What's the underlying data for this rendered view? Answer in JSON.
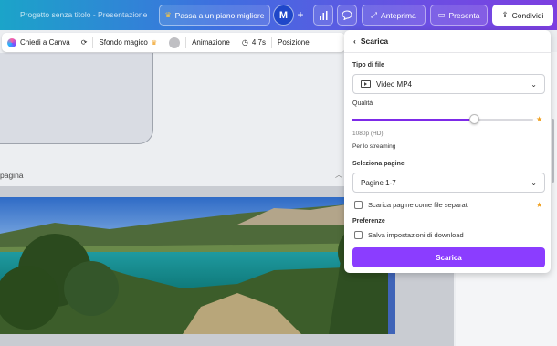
{
  "topbar": {
    "doc_title": "Progetto senza titolo - Presentazione",
    "upgrade_label": "Passa a un piano migliore",
    "avatar_initial": "M",
    "preview_label": "Anteprima",
    "present_label": "Presenta",
    "share_label": "Condividi"
  },
  "context_toolbar": {
    "ask_canva": "Chiedi a Canva",
    "magic_bg": "Sfondo magico",
    "animation": "Animazione",
    "duration": "4.7s",
    "position": "Posizione"
  },
  "canvas": {
    "page_label": "pagina"
  },
  "download_panel": {
    "title": "Scarica",
    "file_type_label": "Tipo di file",
    "file_type_value": "Video MP4",
    "quality_label": "Qualità",
    "quality_fraction": 0.67,
    "quality_value": "1080p (HD)",
    "quality_hint": "Per lo streaming",
    "pages_label": "Seleziona pagine",
    "pages_value": "Pagine 1-7",
    "separate_files_label": "Scarica pagine come file separati",
    "preferences_label": "Preferenze",
    "save_settings_label": "Salva impostazioni di download",
    "download_button": "Scarica"
  },
  "colors": {
    "accent": "#8b3dff",
    "slider_fill": "#7d2ae8",
    "crown": "#f0a020"
  }
}
